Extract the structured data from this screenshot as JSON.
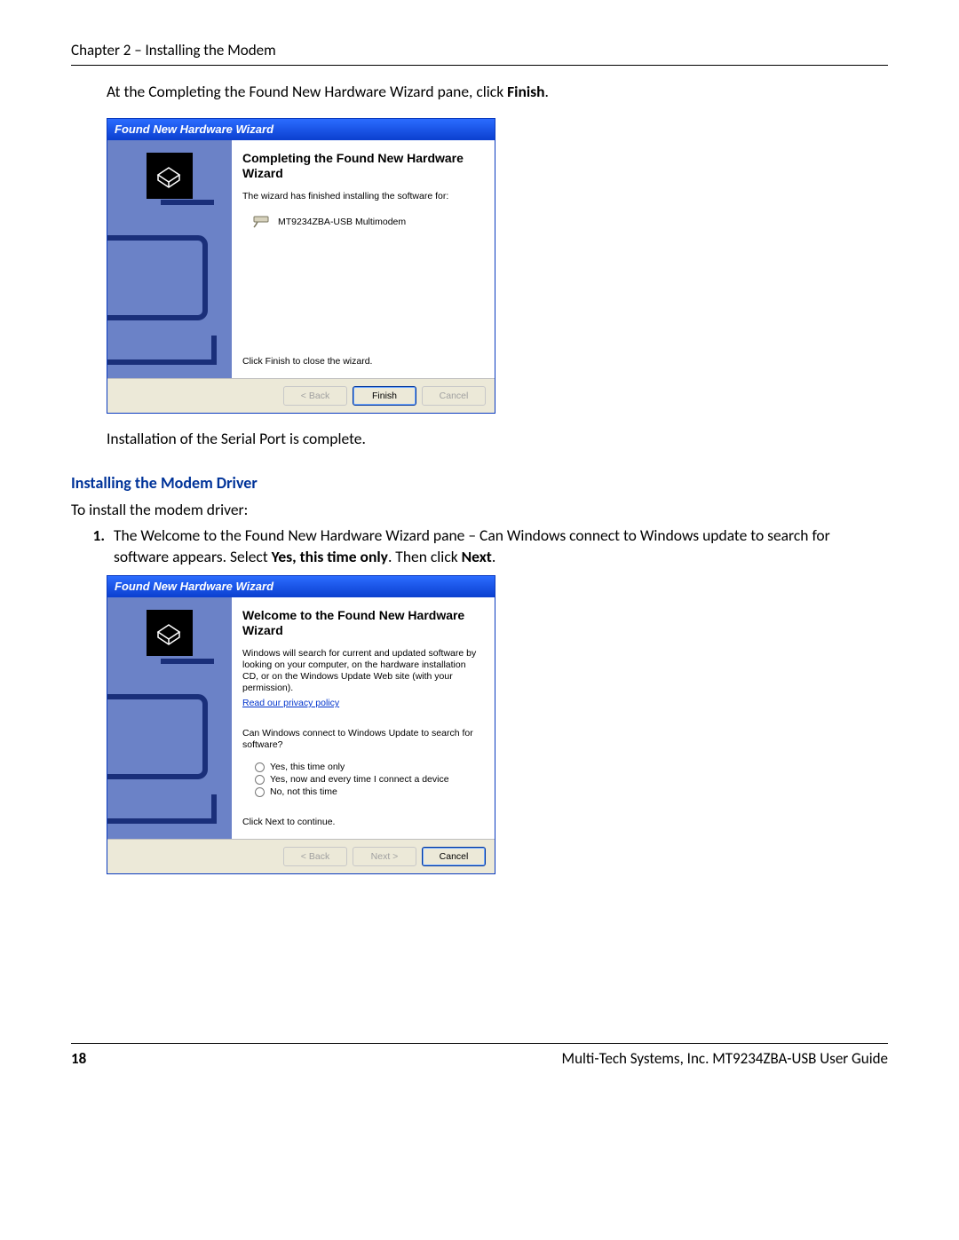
{
  "header": {
    "chapter": "Chapter 2 – Installing the  Modem"
  },
  "body": {
    "intro1_a": "At the Completing the Found New Hardware Wizard pane, click ",
    "intro1_bold": "Finish",
    "intro1_b": ".",
    "post1": "Installation of the Serial Port is complete.",
    "section_title": "Installing the Modem Driver",
    "section_lead": "To install the modem driver:",
    "step1_a": "The Welcome to the Found New Hardware Wizard pane – Can Windows connect to Windows update to search for software appears. Select ",
    "step1_b1": "Yes, this time only",
    "step1_mid": ". Then click ",
    "step1_b2": "Next",
    "step1_end": "."
  },
  "wiz1": {
    "title": "Found New Hardware Wizard",
    "heading": "Completing the Found New Hardware Wizard",
    "line1": "The wizard has finished installing the software for:",
    "device": "MT9234ZBA-USB Multimodem",
    "footnote": "Click Finish to close the wizard.",
    "btn_back": "< Back",
    "btn_finish": "Finish",
    "btn_cancel": "Cancel"
  },
  "wiz2": {
    "title": "Found New Hardware Wizard",
    "heading": "Welcome to the Found New Hardware Wizard",
    "para": "Windows will search for current and updated software by looking on your computer, on the hardware installation CD, or on the Windows Update Web site (with your permission).",
    "link": "Read our privacy policy",
    "question": "Can Windows connect to Windows Update to search for software?",
    "opt1": "Yes, this time only",
    "opt2": "Yes, now and every time I connect a device",
    "opt3": "No, not this time",
    "footnote": "Click Next to continue.",
    "btn_back": "< Back",
    "btn_next": "Next >",
    "btn_cancel": "Cancel"
  },
  "footer": {
    "page": "18",
    "right": "Multi-Tech Systems, Inc. MT9234ZBA-USB User Guide"
  }
}
